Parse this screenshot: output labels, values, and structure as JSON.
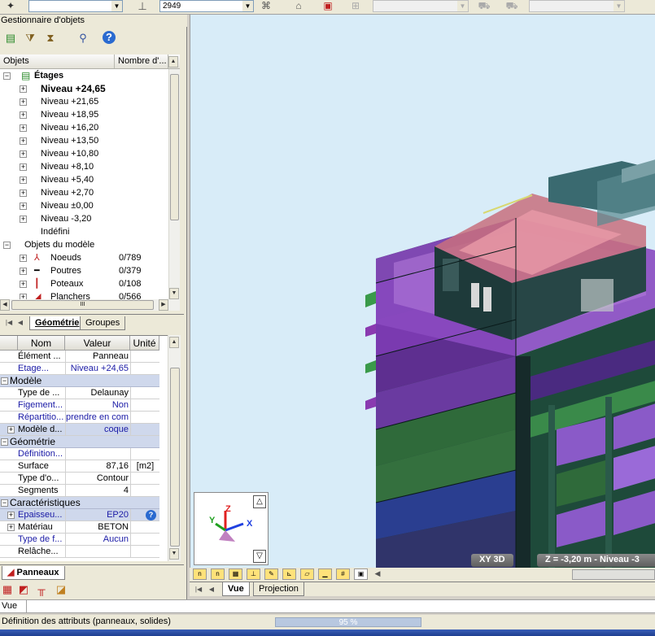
{
  "toolbar": {
    "level_value": "2949",
    "combos_disabled": [
      "",
      ""
    ]
  },
  "object_manager": {
    "title": "Gestionnaire d'objets",
    "columns": [
      "Objets",
      "Nombre d'..."
    ],
    "root": "Étages",
    "levels": [
      {
        "label": "Niveau +24,65",
        "bold": true
      },
      {
        "label": "Niveau +21,65"
      },
      {
        "label": "Niveau +18,95"
      },
      {
        "label": "Niveau +16,20"
      },
      {
        "label": "Niveau +13,50"
      },
      {
        "label": "Niveau +10,80"
      },
      {
        "label": "Niveau +8,10"
      },
      {
        "label": "Niveau +5,40"
      },
      {
        "label": "Niveau +2,70"
      },
      {
        "label": "Niveau ±0,00"
      },
      {
        "label": "Niveau -3,20"
      }
    ],
    "undefined_label": "Indéfini",
    "model_objects": "Objets du modèle",
    "model_items": [
      {
        "label": "Noeuds",
        "count": "0/789",
        "icon": "node-icon"
      },
      {
        "label": "Poutres",
        "count": "0/379",
        "icon": "beam-icon"
      },
      {
        "label": "Poteaux",
        "count": "0/108",
        "icon": "column-icon"
      },
      {
        "label": "Planchers",
        "count": "0/566",
        "icon": "slab-icon"
      }
    ],
    "tabs": [
      "Géométrie",
      "Groupes"
    ],
    "scroll_mark": "III"
  },
  "properties": {
    "headers": [
      "Nom",
      "Valeur",
      "Unité"
    ],
    "top_rows": [
      {
        "name": "Élément ...",
        "value": "Panneau",
        "unit": ""
      },
      {
        "name": "Etage...",
        "value": "Niveau +24,65",
        "unit": "",
        "blue": true
      }
    ],
    "categories": [
      {
        "title": "Modèle",
        "rows": [
          {
            "name": "Type de ...",
            "value": "Delaunay",
            "unit": ""
          },
          {
            "name": "Figement...",
            "value": "Non",
            "unit": "",
            "blue": true
          },
          {
            "name": "Répartitio...",
            "value": "prendre en com",
            "unit": "",
            "blue": true
          },
          {
            "name": "Modèle d...",
            "value": "coque",
            "unit": "",
            "blue": true,
            "expand": true,
            "selected": true
          }
        ]
      },
      {
        "title": "Géométrie",
        "rows": [
          {
            "name": "Définition...",
            "value": "",
            "unit": "",
            "blue": true
          },
          {
            "name": "Surface",
            "value": "87,16",
            "unit": "[m2]"
          },
          {
            "name": "Type d'o...",
            "value": "Contour",
            "unit": ""
          },
          {
            "name": "Segments",
            "value": "4",
            "unit": ""
          }
        ]
      },
      {
        "title": "Caractéristiques",
        "rows": [
          {
            "name": "Epaisseu...",
            "value": "EP20",
            "unit": "",
            "blue": true,
            "expand": true,
            "selected": true,
            "help": true
          },
          {
            "name": "Matériau",
            "value": "BETON",
            "unit": "",
            "expand": true
          },
          {
            "name": "Type de f...",
            "value": "Aucun",
            "unit": "",
            "blue": true
          },
          {
            "name": "Relâche...",
            "value": "",
            "unit": ""
          }
        ]
      }
    ],
    "panel_tab": "Panneaux"
  },
  "viewport": {
    "view_mode": "XY 3D",
    "z_readout": "Z = -3,20 m - Niveau -3",
    "axis_labels": [
      "Z",
      "Y",
      "X"
    ]
  },
  "view_tabs": [
    "Vue",
    "Projection"
  ],
  "command_line": "Vue",
  "status": {
    "message": "Définition des attributs (panneaux, solides)",
    "progress": "95 %",
    "progress_fraction": 0.95
  },
  "colors": {
    "sky": "#d8ecf8",
    "wall_dark": "#1f3a3c",
    "purple": "#7e3a9e",
    "green": "#2f6a3a",
    "pink": "#e89aa8",
    "teal": "#3a6a70"
  }
}
